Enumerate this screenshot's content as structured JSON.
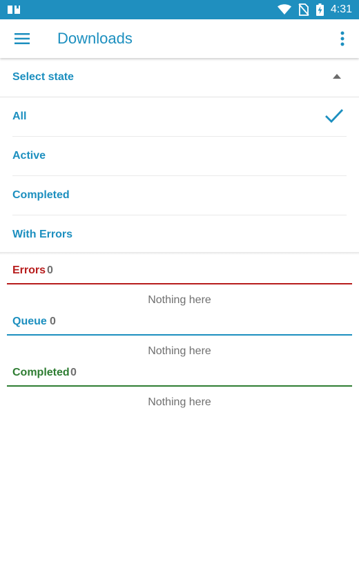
{
  "status_bar": {
    "time": "4:31",
    "icons": [
      "book-icon",
      "wifi-icon",
      "no-sim-icon",
      "battery-charging-icon"
    ]
  },
  "app_bar": {
    "title": "Downloads",
    "icons": [
      "menu-icon",
      "more-vert-icon"
    ]
  },
  "state_selector": {
    "header": "Select state",
    "options": [
      "All",
      "Active",
      "Completed",
      "With Errors"
    ],
    "selected": "All"
  },
  "sections": {
    "errors": {
      "name": "Errors",
      "count": "0",
      "empty": "Nothing here",
      "color": "#b71c1c"
    },
    "queue": {
      "name": "Queue",
      "count": "0",
      "empty": "Nothing here",
      "color": "#1c8fbf"
    },
    "completed": {
      "name": "Completed",
      "count": "0",
      "empty": "Nothing here",
      "color": "#2e7d32"
    }
  },
  "colors": {
    "accent": "#1c8fbf",
    "status_bar": "#1f8fbf"
  }
}
